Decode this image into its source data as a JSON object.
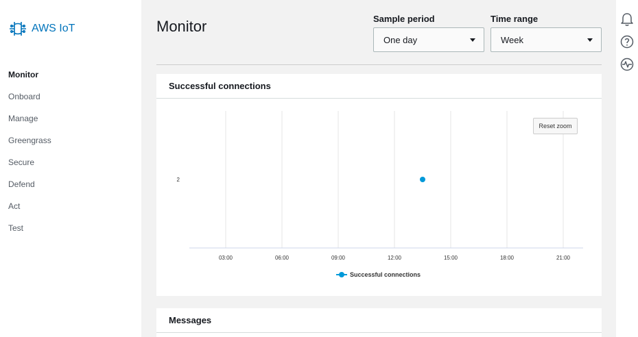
{
  "app": {
    "name": "AWS IoT"
  },
  "sidebar": {
    "items": [
      {
        "label": "Monitor",
        "active": true
      },
      {
        "label": "Onboard"
      },
      {
        "label": "Manage"
      },
      {
        "label": "Greengrass"
      },
      {
        "label": "Secure"
      },
      {
        "label": "Defend"
      },
      {
        "label": "Act"
      },
      {
        "label": "Test"
      }
    ]
  },
  "header": {
    "title": "Monitor",
    "sample_period": {
      "label": "Sample period",
      "value": "One day"
    },
    "time_range": {
      "label": "Time range",
      "value": "Week"
    }
  },
  "cards": {
    "connections": {
      "title": "Successful connections",
      "reset_label": "Reset zoom"
    },
    "messages": {
      "title": "Messages"
    }
  },
  "right_rail": {
    "icons": [
      "bell-icon",
      "help-icon",
      "activity-icon"
    ]
  },
  "colors": {
    "accent": "#0073bb",
    "series": "#0099d9"
  },
  "chart_data": {
    "type": "scatter",
    "title": "Successful connections",
    "x_ticks": [
      "03:00",
      "06:00",
      "09:00",
      "12:00",
      "15:00",
      "18:00",
      "21:00"
    ],
    "y_ticks": [
      "2"
    ],
    "series": [
      {
        "name": "Successful connections",
        "points": [
          {
            "x": "13:30",
            "y": 2
          }
        ]
      }
    ],
    "legend_position": "bottom-center",
    "grid": "vertical"
  }
}
